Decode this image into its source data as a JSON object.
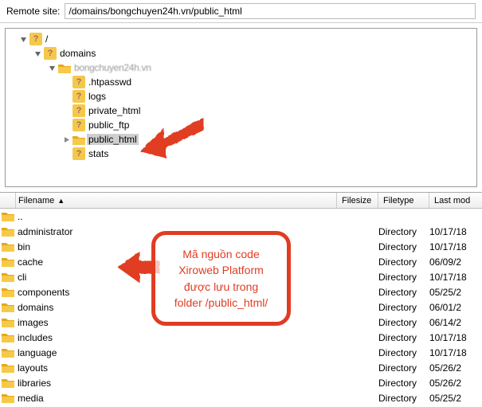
{
  "topbar": {
    "label": "Remote site:",
    "path": "/domains/bongchuyen24h.vn/public_html"
  },
  "tree": {
    "root": "/",
    "domains": "domains",
    "host_blur": "bongchuyen24h.vn",
    "htpasswd": ".htpasswd",
    "logs": "logs",
    "private_html": "private_html",
    "public_ftp": "public_ftp",
    "public_html": "public_html",
    "stats": "stats"
  },
  "list": {
    "header": {
      "filename": "Filename",
      "filesize": "Filesize",
      "filetype": "Filetype",
      "lastmod": "Last mod"
    },
    "rows": [
      {
        "name": "..",
        "size": "",
        "type": "",
        "date": ""
      },
      {
        "name": "administrator",
        "size": "",
        "type": "Directory",
        "date": "10/17/18"
      },
      {
        "name": "bin",
        "size": "",
        "type": "Directory",
        "date": "10/17/18"
      },
      {
        "name": "cache",
        "size": "",
        "type": "Directory",
        "date": "06/09/2"
      },
      {
        "name": "cli",
        "size": "",
        "type": "Directory",
        "date": "10/17/18"
      },
      {
        "name": "components",
        "size": "",
        "type": "Directory",
        "date": "05/25/2"
      },
      {
        "name": "domains",
        "size": "",
        "type": "Directory",
        "date": "06/01/2"
      },
      {
        "name": "images",
        "size": "",
        "type": "Directory",
        "date": "06/14/2"
      },
      {
        "name": "includes",
        "size": "",
        "type": "Directory",
        "date": "10/17/18"
      },
      {
        "name": "language",
        "size": "",
        "type": "Directory",
        "date": "10/17/18"
      },
      {
        "name": "layouts",
        "size": "",
        "type": "Directory",
        "date": "05/26/2"
      },
      {
        "name": "libraries",
        "size": "",
        "type": "Directory",
        "date": "05/26/2"
      },
      {
        "name": "media",
        "size": "",
        "type": "Directory",
        "date": "05/25/2"
      }
    ]
  },
  "annotation": {
    "line1": "Mã nguồn code",
    "line2": "Xiroweb Platform",
    "line3": "được lưu trong",
    "line4": "folder /public_html/"
  }
}
